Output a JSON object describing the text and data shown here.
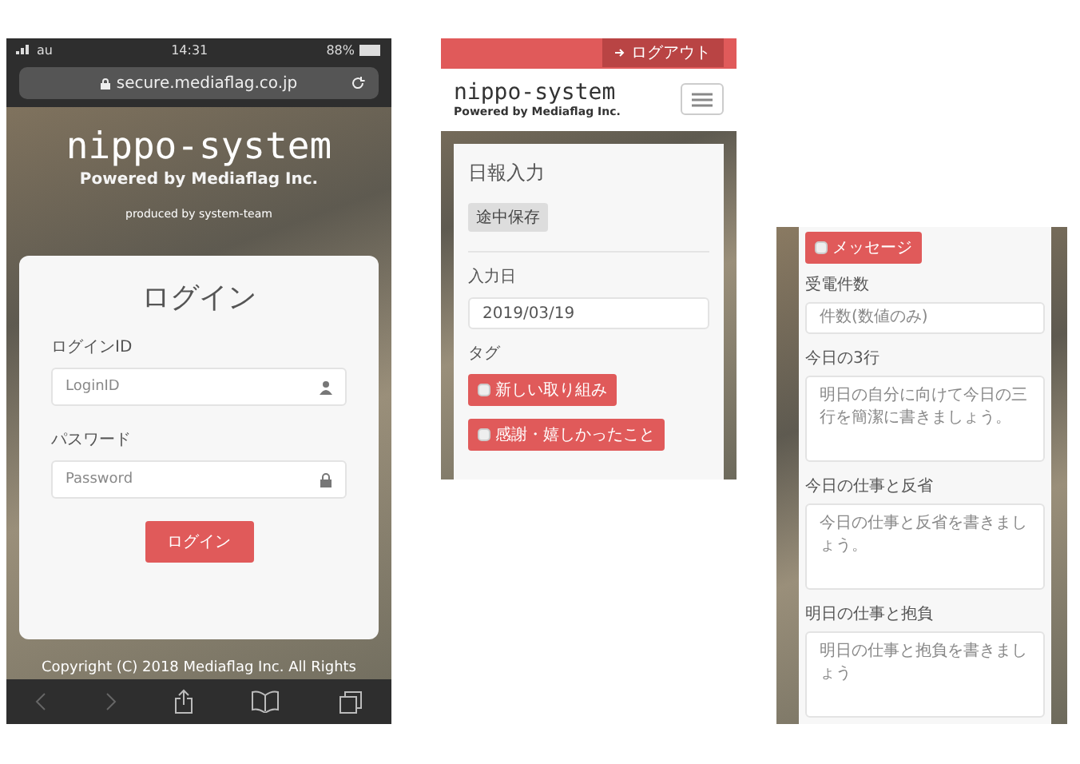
{
  "login_phone": {
    "status_bar": {
      "carrier": "au",
      "time": "14:31",
      "battery": "88%"
    },
    "address_bar": {
      "url": "secure.mediaflag.co.jp"
    },
    "hero": {
      "title": "nippo-system",
      "subtitle": "Powered by Mediaflag Inc.",
      "credit": "produced by system-team"
    },
    "login_card": {
      "title": "ログイン",
      "fields": [
        {
          "label": "ログインID",
          "placeholder": "LoginID",
          "kind": "user"
        },
        {
          "label": "パスワード",
          "placeholder": "Password",
          "kind": "lock"
        }
      ],
      "submit": "ログイン"
    },
    "footer": "Copyright (C) 2018 Mediaflag Inc. All Rights"
  },
  "report_phone": {
    "logout": "ログアウト",
    "brand": {
      "title": "nippo-system",
      "subtitle": "Powered by Mediaflag Inc."
    },
    "card": {
      "title": "日報入力",
      "draft_button": "途中保存",
      "date": {
        "label": "入力日",
        "value": "2019/03/19"
      },
      "tag_label": "タグ",
      "tags": [
        "新しい取り組み",
        "感謝・嬉しかったこと"
      ]
    }
  },
  "report_form_phone": {
    "message_tag": "メッセージ",
    "fields": [
      {
        "label": "受電件数",
        "placeholder": "件数(数値のみ)",
        "kind": "input"
      },
      {
        "label": "今日の3行",
        "placeholder": "明日の自分に向けて今日の三行を簡潔に書きましょう。",
        "kind": "textarea"
      },
      {
        "label": "今日の仕事と反省",
        "placeholder": "今日の仕事と反省を書きましょう。",
        "kind": "textarea"
      },
      {
        "label": "明日の仕事と抱負",
        "placeholder": "明日の仕事と抱負を書きましょう",
        "kind": "textarea"
      }
    ]
  }
}
